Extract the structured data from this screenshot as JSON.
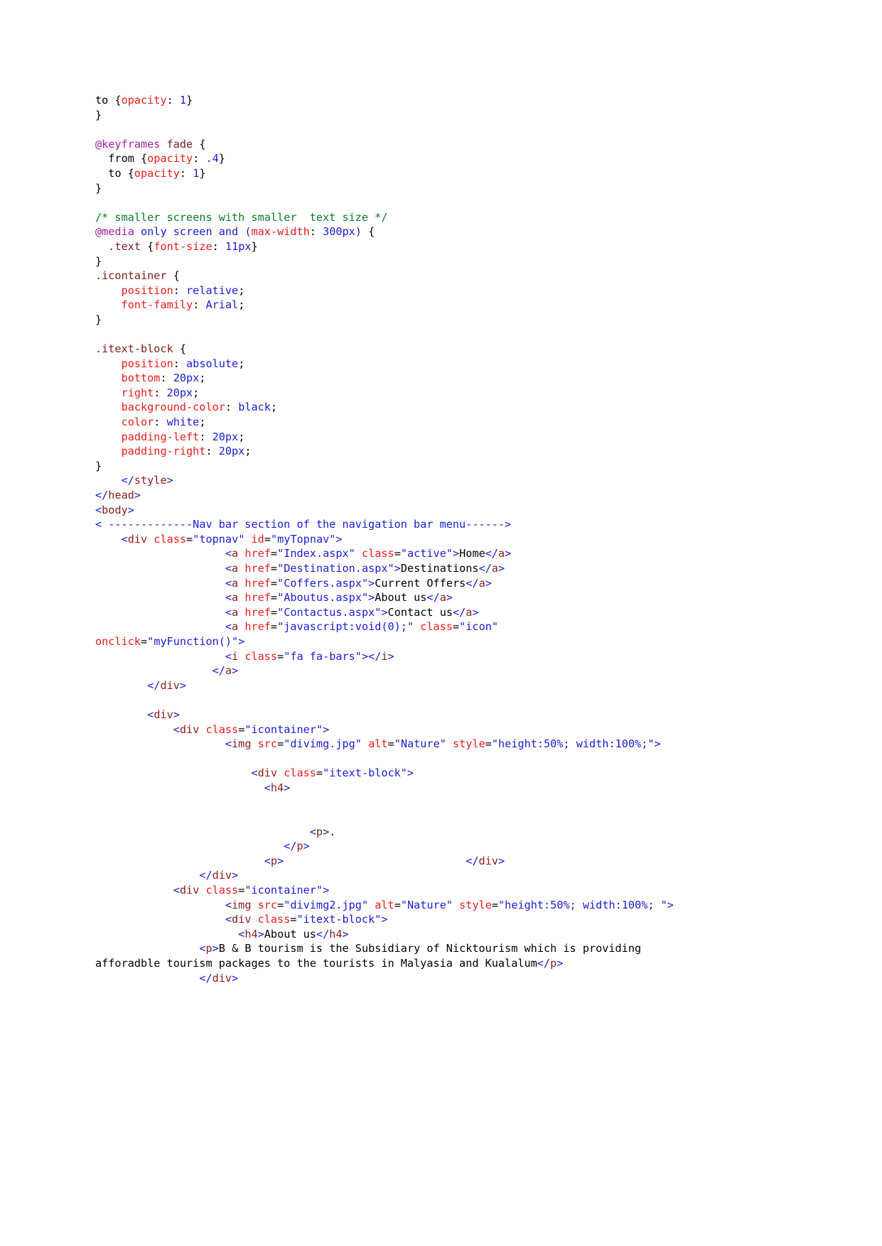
{
  "document": {
    "kind": "source-code-listing",
    "language": "HTML/CSS",
    "background_color": "#ffffff",
    "colors": {
      "comment": "#0a7a28",
      "at_rule": "#a020a0",
      "selector": "#7a2020",
      "property": "#e81c1c",
      "value": "#1b1bd0",
      "tag_bracket": "#1b1bd0",
      "tag_name": "#8a1c1c",
      "attr_name": "#e81c1c",
      "attr_value": "#1b1bd0",
      "plain_text": "#000000"
    }
  },
  "css": {
    "fade_tail": {
      "to_keyword": "to ",
      "brace_open": "{",
      "prop_opacity": "opacity",
      "colon": ": ",
      "val_one": "1",
      "brace_close": "}",
      "close_brace": "}"
    },
    "keyframes_fade": {
      "at_rule": "@keyframes",
      "name": " fade ",
      "open": "{",
      "from_keyword": "  from ",
      "from_open": "{",
      "from_prop": "opacity",
      "from_colon": ": ",
      "from_val": ".4",
      "from_close": "}",
      "to_keyword": "  to ",
      "to_open": "{",
      "to_prop": "opacity",
      "to_colon": ": ",
      "to_val": "1",
      "to_close": "}",
      "close": "}"
    },
    "media_comment": "/* smaller screens with smaller  text size */",
    "media_rule": {
      "at_rule": "@media",
      "conditions": " only screen and ",
      "paren_open": "(",
      "feature": "max-width",
      "colon": ": ",
      "value": "300px",
      "paren_close": ")",
      "brace": " {",
      "inner_selector": "  .text ",
      "inner_open": "{",
      "inner_prop": "font-size",
      "inner_colon": ": ",
      "inner_value": "11px",
      "inner_close": "}",
      "close": "}"
    },
    "icontainer": {
      "selector": ".icontainer",
      "open": " {",
      "declarations": [
        {
          "property": "position",
          "value": "relative",
          "semicolon": ";"
        },
        {
          "property": "font-family",
          "value": "Arial",
          "semicolon": ";"
        }
      ],
      "close": "}"
    },
    "itext_block": {
      "selector": ".itext-block",
      "open": " {",
      "declarations": [
        {
          "property": "position",
          "value": "absolute",
          "semicolon": ";"
        },
        {
          "property": "bottom",
          "value": "20px",
          "semicolon": ";"
        },
        {
          "property": "right",
          "value": "20px",
          "semicolon": ";"
        },
        {
          "property": "background-color",
          "value": "black",
          "semicolon": ";"
        },
        {
          "property": "color",
          "value": "white",
          "semicolon": ";"
        },
        {
          "property": "padding-left",
          "value": "20px",
          "semicolon": ";"
        },
        {
          "property": "padding-right",
          "value": "20px",
          "semicolon": ";"
        }
      ],
      "close": "}"
    },
    "style_close": "</style>"
  },
  "html": {
    "head_close": "</head>",
    "body_open": "<body>",
    "navbar_comment": "< -------------Nav bar section of the navigation bar menu------>",
    "topnav": {
      "tag": "div",
      "attr_class_name": "class",
      "attr_class_value": "\"topnav\"",
      "attr_id_name": "id",
      "attr_id_value": "\"myTopnav\"",
      "links": [
        {
          "attr": "href",
          "value": "\"Index.aspx\"",
          "extra_attr": "class",
          "extra_value": "\"active\"",
          "text": "Home"
        },
        {
          "attr": "href",
          "value": "\"Destination.aspx\"",
          "extra_attr": "",
          "extra_value": "",
          "text": "Destinations"
        },
        {
          "attr": "href",
          "value": "\"Coffers.aspx\"",
          "extra_attr": "",
          "extra_value": "",
          "text": "Current Offers"
        },
        {
          "attr": "href",
          "value": "\"Aboutus.aspx\"",
          "extra_attr": "",
          "extra_value": "",
          "text": "About us"
        },
        {
          "attr": "href",
          "value": "\"Contactus.aspx\"",
          "extra_attr": "",
          "extra_value": "",
          "text": "Contact us"
        }
      ],
      "icon_link": {
        "attr": "href",
        "value": "\"javascript:void(0);\"",
        "class_attr": "class",
        "class_value": "\"icon\"",
        "onclick_attr": "onclick",
        "onclick_value": "\"myFunction()\""
      },
      "icon_i": {
        "tag": "i",
        "attr": "class",
        "value": "\"fa fa-bars\"",
        "close": "</i>"
      },
      "anchor_close": "</a>",
      "div_close": "</div>"
    },
    "wrapper_div_open": "<div>",
    "container1": {
      "div_tag": "div",
      "div_attr": "class",
      "div_value": "\"icontainer\"",
      "img_tag": "img",
      "img_src_attr": "src",
      "img_src_value": "\"divimg.jpg\"",
      "img_alt_attr": "alt",
      "img_alt_value": "\"Nature\"",
      "img_style_attr": "style",
      "img_style_value": "\"height:50%; width:100%;\"",
      "text_block_attr": "class",
      "text_block_value": "\"itext-block\"",
      "h4_open": "<h4>",
      "p_dot": "<p>.",
      "p_close": "</p>",
      "p_open": "<p>",
      "div_close": "</div>"
    },
    "container2": {
      "div_tag": "div",
      "div_attr": "class",
      "div_value": "\"icontainer\"",
      "img_src_value": "\"divimg2.jpg\"",
      "img_alt_value": "\"Nature\"",
      "img_style_value": "\"height:50%; width:100%; \"",
      "text_block_value": "\"itext-block\"",
      "h4_text": "About us",
      "h4_open": "<h4>",
      "h4_close": "</h4>",
      "paragraph": "B & B tourism is the Subsidiary of Nicktourism which is providing afforadble tourism packages to the tourists in Malyasia and Kualalum",
      "p_close": "</p>",
      "div_close": "</div>"
    }
  }
}
